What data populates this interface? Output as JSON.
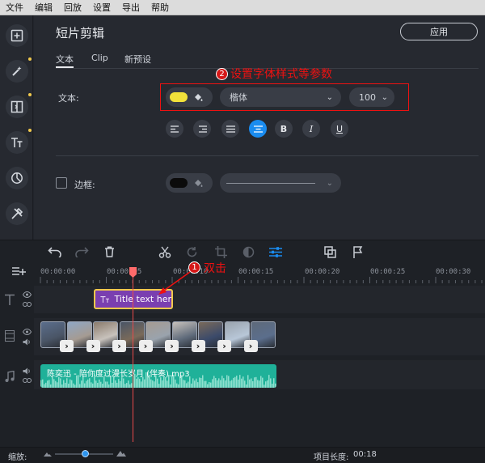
{
  "menu": [
    "文件",
    "编辑",
    "回放",
    "设置",
    "导出",
    "帮助"
  ],
  "sidebar": {
    "items": [
      {
        "name": "import",
        "icon": "add-file-icon",
        "dot": false
      },
      {
        "name": "filters",
        "icon": "magic-wand-icon",
        "dot": true
      },
      {
        "name": "transitions",
        "icon": "transition-icon",
        "dot": true
      },
      {
        "name": "titles",
        "icon": "text-icon",
        "dot": true
      },
      {
        "name": "stickers",
        "icon": "pie-icon",
        "dot": false
      },
      {
        "name": "tools",
        "icon": "tools-icon",
        "dot": false
      }
    ]
  },
  "editor": {
    "title": "短片剪辑",
    "apply_label": "应用",
    "tabs": [
      "文本",
      "Clip",
      "新预设"
    ],
    "active_tab": "文本",
    "text_label": "文本:",
    "text_color": "#f2e23a",
    "font_name": "楷体",
    "font_size": "100",
    "format_buttons": [
      "left-align",
      "right-align",
      "justify",
      "center-align",
      "B",
      "I",
      "U"
    ],
    "format_glyphs": {
      "bold": "B",
      "italic": "I",
      "underline": "U"
    },
    "border_label": "边框:",
    "border_color": "#0b0b0b"
  },
  "annotations": {
    "step2_number": "2",
    "step2_text": "设置字体样式等参数",
    "step1_number": "1",
    "step1_text": "双击"
  },
  "timeline": {
    "ruler": [
      "00:00:00",
      "00:00:05",
      "00:00:10",
      "00:00:15",
      "00:00:20",
      "00:00:25",
      "00:00:30"
    ],
    "title_clip_label": "Title text her",
    "audio_clip_label": "陈奕迅 - 陪你度过漫长岁月 (伴奏).mp3",
    "accent": "#1fb199",
    "title_clip_color": "#7a3fb0"
  },
  "status": {
    "zoom_label": "缩放:",
    "zoom_value": 0.52,
    "project_length_label": "项目长度:",
    "project_length": "00:18"
  }
}
